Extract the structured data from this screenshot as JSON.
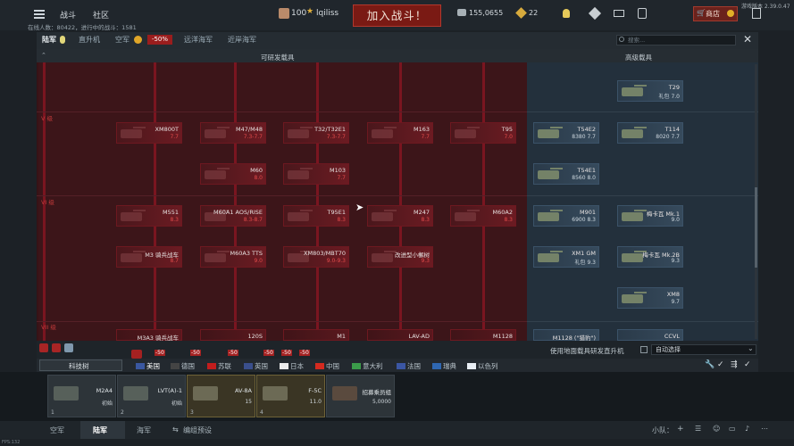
{
  "topbar": {
    "menu_left": [
      "战斗",
      "社区"
    ],
    "player_level": "100",
    "player_name": "lqiliss",
    "battle_button": "加入战斗！",
    "silver": "155,0655",
    "gold": "22",
    "shop": "商店",
    "online": "在线人数：80422，进行中的战斗：1581",
    "version": "游戏版本 2.39.0.47"
  },
  "tabs": {
    "items": [
      "陆军",
      "直升机",
      "空军",
      "远洋海军",
      "近岸海军"
    ],
    "discount": "-50%",
    "search_placeholder": "搜索..."
  },
  "headers": {
    "researchable": "可研发载具",
    "premium": "高级载具"
  },
  "ranks": [
    "V 级",
    "VI 级",
    "VII 级"
  ],
  "vehicles": {
    "r0": {
      "name": "XM800T",
      "br": "7.7"
    },
    "r1": {
      "name": "M47/M48",
      "br": "7.3-7.7"
    },
    "r2": {
      "name": "T32/T32E1",
      "br": "7.3-7.7"
    },
    "r3": {
      "name": "M163",
      "br": "7.7"
    },
    "r4": {
      "name": "T95",
      "br": "7.0"
    },
    "r5": {
      "name": "M60",
      "br": "8.0"
    },
    "r6": {
      "name": "M103",
      "br": "7.7"
    },
    "r7": {
      "name": "M551",
      "br": "8.3"
    },
    "r8": {
      "name": "M60A1 AOS/RISE",
      "br": "8.3-8.7"
    },
    "r9": {
      "name": "T95E1",
      "br": "8.3"
    },
    "r10": {
      "name": "M247",
      "br": "8.3"
    },
    "r11": {
      "name": "M60A2",
      "br": "8.3"
    },
    "r12": {
      "name": "M3 骑兵战车",
      "br": "8.7"
    },
    "r13": {
      "name": "M60A3 TTS",
      "br": "9.0"
    },
    "r14": {
      "name": "XM803/MBT70",
      "br": "9.0-9.3"
    },
    "r15": {
      "name": "改进型小檞树",
      "br": "9.3"
    },
    "r16": {
      "name": "M3A3 骑兵战车",
      "br": ""
    },
    "r17": {
      "name": "120S",
      "br": ""
    },
    "r18": {
      "name": "M1",
      "br": ""
    },
    "r19": {
      "name": "LAV-AD",
      "br": ""
    },
    "r20": {
      "name": "M1128",
      "br": ""
    },
    "p0": {
      "name": "T29",
      "br": "礼包 7.0"
    },
    "p1": {
      "name": "T54E2",
      "br": "8380 7.7"
    },
    "p2": {
      "name": "T114",
      "br": "8020 7.7"
    },
    "p3": {
      "name": "T54E1",
      "br": "8560 8.0"
    },
    "p4": {
      "name": "M901",
      "br": "6900 8.3"
    },
    "p5": {
      "name": "梅卡瓦 Mk.1",
      "br": "9.0"
    },
    "p6": {
      "name": "XM1 GM",
      "br": "礼包 9.3"
    },
    "p7": {
      "name": "梅卡瓦 Mk.2B",
      "br": "9.3"
    },
    "p8": {
      "name": "XM8",
      "br": "9.7"
    },
    "p9": {
      "name": "M1128 (\"猎豹\")",
      "br": ""
    },
    "p10": {
      "name": "CCVL",
      "br": ""
    }
  },
  "options": {
    "direct_research": "使用地面载具研发直升机",
    "auto_select": "自动选择"
  },
  "tech_tree": "科技树",
  "nations": [
    "美国",
    "德国",
    "苏联",
    "英国",
    "日本",
    "中国",
    "意大利",
    "法国",
    "瑞典",
    "以色列"
  ],
  "discounts": [
    "-50",
    "-50",
    "-50",
    "-50",
    "-50",
    "-50"
  ],
  "crew": [
    {
      "name": "M2A4",
      "sub": "初始",
      "slot": "1"
    },
    {
      "name": "LVT(A)-1",
      "sub": "初始",
      "slot": "2"
    },
    {
      "name": "AV-8A",
      "sub": "15",
      "slot": "3"
    },
    {
      "name": "F-5C",
      "sub": "11.0",
      "slot": "4"
    },
    {
      "name": "招募乘员组",
      "sub": "5,0000",
      "slot": ""
    }
  ],
  "bottom_nav": [
    "空军",
    "陆军",
    "海军",
    "编组预设"
  ],
  "squad_label": "小队：",
  "fps": "FPS:132",
  "colors": {
    "accent_red": "#7a1a14",
    "research_red": "#3c1519",
    "premium_blue": "#23303c"
  }
}
